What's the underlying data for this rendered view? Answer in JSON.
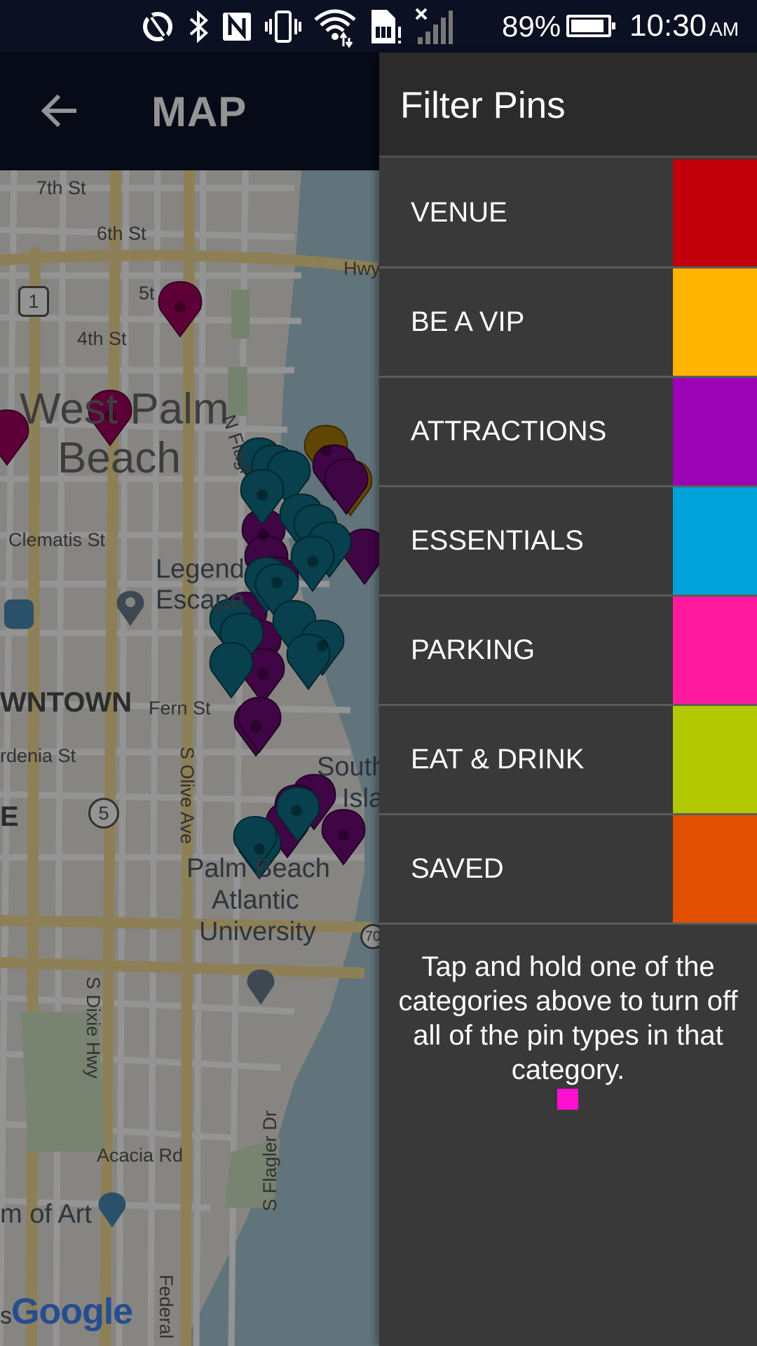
{
  "status_bar": {
    "battery_percent": "89%",
    "time": "10:30",
    "ampm": "AM",
    "icons": [
      "nfc-tap-icon",
      "bluetooth-icon",
      "nfc-icon",
      "vibrate-icon",
      "wifi-icon",
      "sim-alert-icon",
      "signal-no-service-icon",
      "battery-icon"
    ]
  },
  "app_bar": {
    "title": "MAP",
    "back_icon": "arrow-left-icon"
  },
  "map": {
    "labels": {
      "seventh": "7th St",
      "sixth": "6th St",
      "fifth": "5t",
      "fourth": "4th St",
      "hwy": "Hwy",
      "route1": "1",
      "west_palm": "West Palm",
      "beach": "Beach",
      "n_flagler": "N Flagl",
      "clematis": "Clematis St",
      "legend": "Legend",
      "escape": "Escape",
      "downtown": "WNTOWN",
      "fern": "Fern St",
      "gardenia": "rdenia St",
      "e_letter": "E",
      "route5": "5",
      "s_olive": "S Olive Ave",
      "south": "South",
      "isla": "Isla",
      "palm_beach": "Palm Beach",
      "atlantic": "Atlantic",
      "university": "University",
      "route70": "70",
      "s_dixie": "S Dixie Hwy",
      "acacia": "Acacia Rd",
      "s_flagler": "S Flagler Dr",
      "art": "m of Art",
      "federal": "Federal",
      "s_prefix": "s",
      "google": "Google"
    },
    "pin_colors": {
      "parking": "#a1005f",
      "attractions": "#6e0a75",
      "essentials": "#0f6f86",
      "venue_gold": "#a8780a"
    }
  },
  "drawer": {
    "title": "Filter Pins",
    "items": [
      {
        "label": "VENUE",
        "color": "#c1000b"
      },
      {
        "label": "BE A VIP",
        "color": "#ffb400"
      },
      {
        "label": "ATTRACTIONS",
        "color": "#9c03b5"
      },
      {
        "label": "ESSENTIALS",
        "color": "#00a3d9"
      },
      {
        "label": "PARKING",
        "color": "#ff1a9f"
      },
      {
        "label": "EAT & DRINK",
        "color": "#b2c800"
      },
      {
        "label": "SAVED",
        "color": "#e14f00"
      }
    ],
    "hint": "Tap and hold one of the categories above to turn off all of the pin types in that category.",
    "hint_dot_color": "#ff0fcf"
  }
}
